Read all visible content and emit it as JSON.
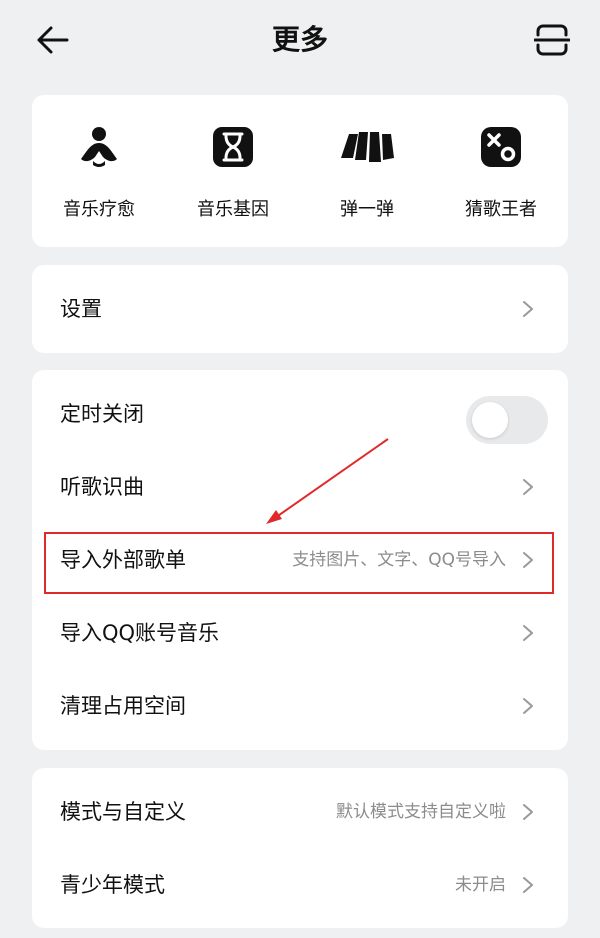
{
  "header": {
    "title": "更多",
    "back_icon": "arrow-left-icon",
    "scan_icon": "scan-icon"
  },
  "shortcuts": [
    {
      "label": "音乐疗愈",
      "icon": "person-heal-icon"
    },
    {
      "label": "音乐基因",
      "icon": "dna-icon"
    },
    {
      "label": "弹一弹",
      "icon": "piano-keys-icon"
    },
    {
      "label": "猜歌王者",
      "icon": "x-o-game-icon"
    }
  ],
  "settings": {
    "label": "设置"
  },
  "tools": {
    "timer_close": {
      "label": "定时关闭",
      "toggle_on": false
    },
    "song_recognition": {
      "label": "听歌识曲"
    },
    "import_playlist": {
      "label": "导入外部歌单",
      "hint": "支持图片、文字、QQ号导入"
    },
    "import_qq": {
      "label": "导入QQ账号音乐"
    },
    "clear_space": {
      "label": "清理占用空间"
    }
  },
  "mode": {
    "custom_mode": {
      "label": "模式与自定义",
      "hint": "默认模式支持自定义啦"
    },
    "teen_mode": {
      "label": "青少年模式",
      "hint": "未开启"
    }
  },
  "colors": {
    "background": "#eef0f1",
    "card": "#ffffff",
    "secondary_text": "#8c8c8c",
    "annotation_red": "#e02a2a"
  }
}
